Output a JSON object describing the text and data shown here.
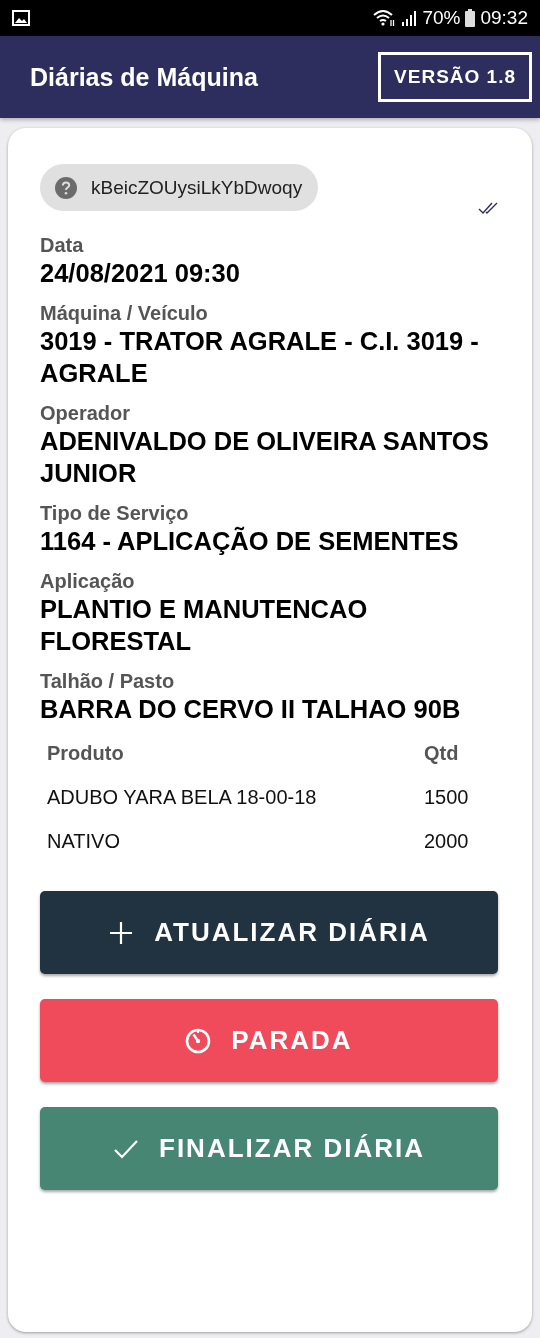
{
  "status_bar": {
    "battery": "70%",
    "time": "09:32"
  },
  "app_bar": {
    "title": "Diárias de Máquina",
    "version": "VERSÃO 1.8"
  },
  "card": {
    "chip": {
      "text": "kBeicZOUysiLkYbDwoqy"
    },
    "synced": true,
    "fields": [
      {
        "label": "Data",
        "value": "24/08/2021 09:30"
      },
      {
        "label": "Máquina / Veículo",
        "value": "3019 - TRATOR AGRALE - C.I. 3019 - AGRALE"
      },
      {
        "label": "Operador",
        "value": "ADENIVALDO DE OLIVEIRA SANTOS JUNIOR"
      },
      {
        "label": "Tipo de Serviço",
        "value": "1164 - APLICAÇÃO DE SEMENTES"
      },
      {
        "label": "Aplicação",
        "value": "PLANTIO E MANUTENCAO FLORESTAL"
      },
      {
        "label": "Talhão / Pasto",
        "value": "BARRA DO CERVO II TALHAO 90B"
      }
    ],
    "table": {
      "columns": [
        "Produto",
        "Qtd"
      ],
      "rows": [
        [
          "ADUBO YARA BELA 18-00-18",
          "1500"
        ],
        [
          "NATIVO",
          "2000"
        ]
      ]
    },
    "buttons": [
      {
        "kind": "add",
        "label": "ATUALIZAR DIÁRIA"
      },
      {
        "kind": "stop",
        "label": "PARADA"
      },
      {
        "kind": "finish",
        "label": "FINALIZAR DIÁRIA"
      }
    ]
  }
}
